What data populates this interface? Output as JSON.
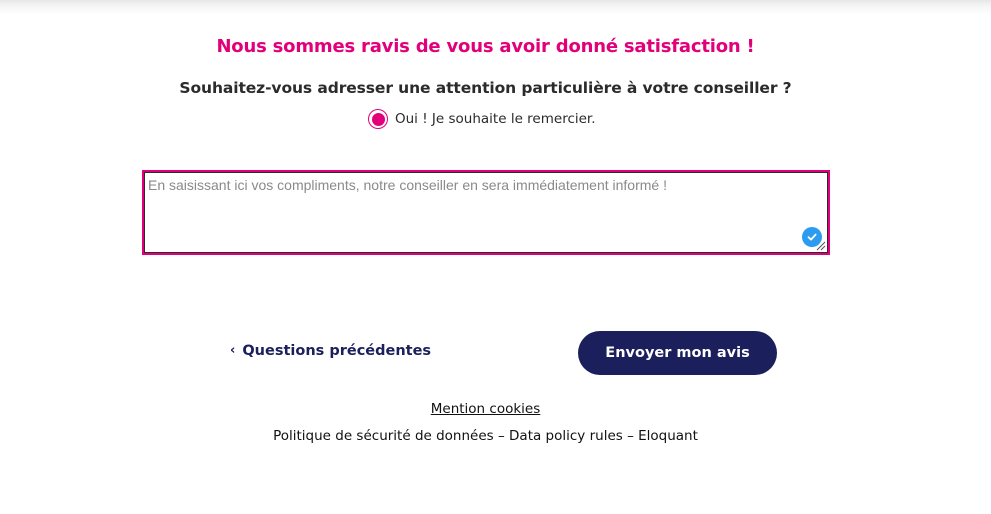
{
  "headline": "Nous sommes ravis de vous avoir donné satisfaction !",
  "question": "Souhaitez-vous adresser une attention particulière à votre conseiller ?",
  "radio": {
    "label": "Oui ! Je souhaite le remercier.",
    "selected": true
  },
  "compliment": {
    "value": "",
    "placeholder": "En saisissant ici vos compliments, notre conseiller en sera immédiatement informé !"
  },
  "navigation": {
    "prev_chevron": "‹",
    "prev_label": "Questions précédentes",
    "submit_label": "Envoyer mon avis"
  },
  "footer": {
    "cookies_label": "Mention cookies",
    "policy_text": "Politique de sécurité de données – Data policy rules – Eloquant"
  },
  "colors": {
    "accent": "#e2007a",
    "navy": "#1b1f5c",
    "check_badge": "#2d9cf0"
  }
}
